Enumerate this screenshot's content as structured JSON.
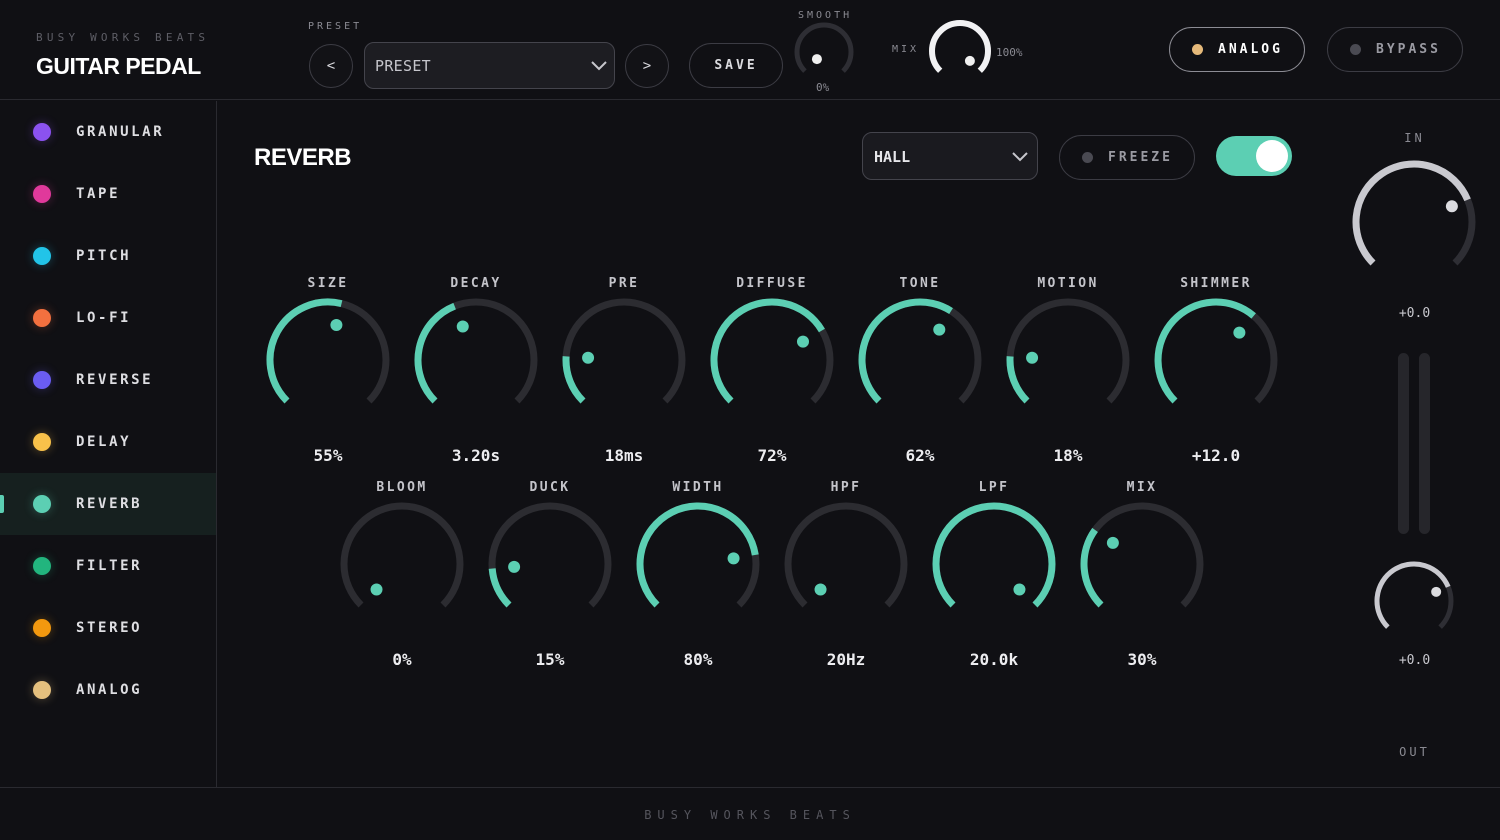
{
  "brand": {
    "subtitle": "BUSY WORKS BEATS",
    "title": "GUITAR PEDAL"
  },
  "header": {
    "preset_label": "PRESET",
    "preset_prev": "<",
    "preset_next": ">",
    "preset_value": "PRESET",
    "save_label": "SAVE",
    "smooth_label": "SMOOTH",
    "smooth_value": "0%",
    "smooth_level": 0,
    "mix_label": "MIX",
    "mix_value": "100%",
    "mix_level": 1.0,
    "analog_label": "ANALOG",
    "analog_dot_color": "#e5b97a",
    "bypass_label": "BYPASS",
    "bypass_dot_color": "#4a4a52"
  },
  "sidebar": {
    "items": [
      {
        "label": "GRANULAR",
        "color": "#8b52f0"
      },
      {
        "label": "TAPE",
        "color": "#e0399b"
      },
      {
        "label": "PITCH",
        "color": "#22c4e8"
      },
      {
        "label": "LO-FI",
        "color": "#f2703f"
      },
      {
        "label": "REVERSE",
        "color": "#6a5cf2"
      },
      {
        "label": "DELAY",
        "color": "#f8c14a"
      },
      {
        "label": "REVERB",
        "color": "#5ccfb3",
        "active": true
      },
      {
        "label": "FILTER",
        "color": "#22b57e"
      },
      {
        "label": "STEREO",
        "color": "#f2980f"
      },
      {
        "label": "ANALOG",
        "color": "#e5c07e"
      }
    ]
  },
  "main": {
    "title": "REVERB",
    "mode_value": "HALL",
    "freeze_label": "FREEZE",
    "freeze_dot_color": "#4a4a52",
    "enabled": true,
    "accent_color": "#5ccfb3",
    "knobs_row1": [
      {
        "name": "SIZE",
        "value": "55%",
        "level": 0.55
      },
      {
        "name": "DECAY",
        "value": "3.20s",
        "level": 0.42
      },
      {
        "name": "PRE",
        "value": "18ms",
        "level": 0.18
      },
      {
        "name": "DIFFUSE",
        "value": "72%",
        "level": 0.72
      },
      {
        "name": "TONE",
        "value": "62%",
        "level": 0.62
      },
      {
        "name": "MOTION",
        "value": "18%",
        "level": 0.18
      },
      {
        "name": "SHIMMER",
        "value": "+12.0",
        "level": 0.65
      }
    ],
    "knobs_row2": [
      {
        "name": "BLOOM",
        "value": "0%",
        "level": 0.0
      },
      {
        "name": "DUCK",
        "value": "15%",
        "level": 0.15
      },
      {
        "name": "WIDTH",
        "value": "80%",
        "level": 0.8
      },
      {
        "name": "HPF",
        "value": "20Hz",
        "level": 0.0
      },
      {
        "name": "LPF",
        "value": "20.0k",
        "level": 1.0
      },
      {
        "name": "MIX",
        "value": "30%",
        "level": 0.3
      }
    ]
  },
  "io": {
    "in_label": "IN",
    "in_value": "+0.0",
    "in_level": 0.75,
    "out_value": "+0.0",
    "out_level": 0.75,
    "out_label": "OUT"
  },
  "footer": {
    "text": "BUSY WORKS BEATS"
  }
}
